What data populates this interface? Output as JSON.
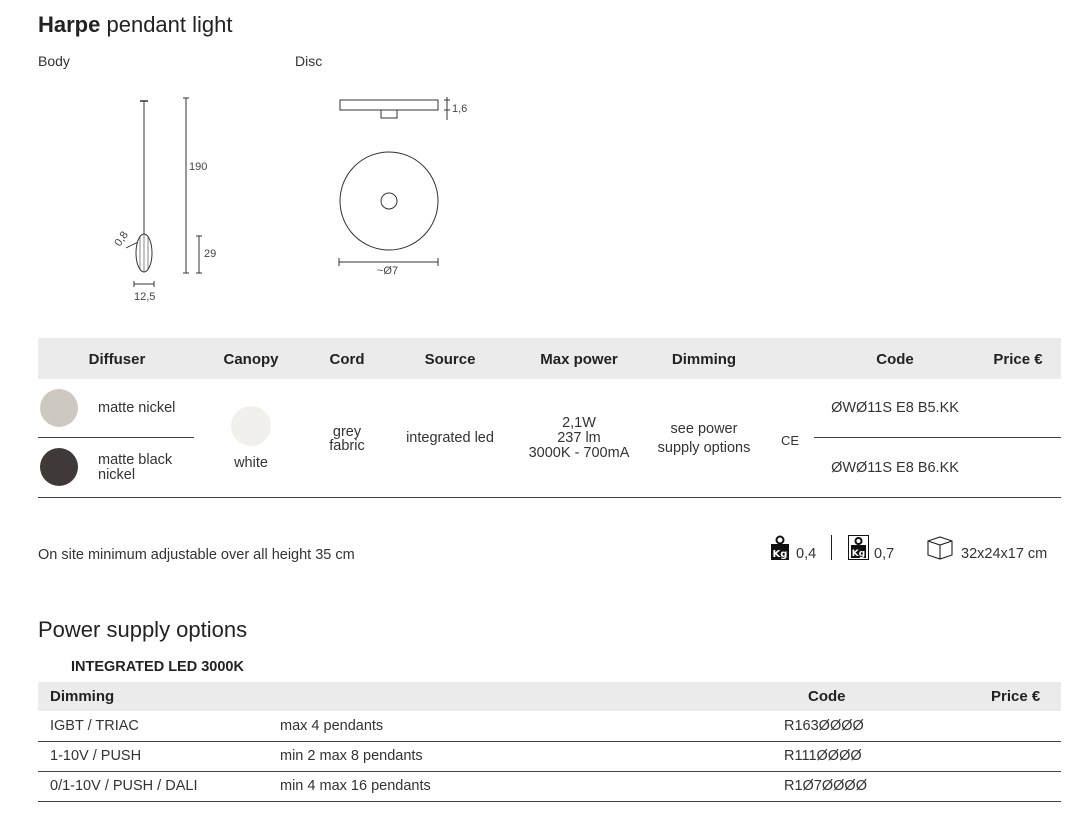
{
  "product": {
    "name": "Harpe",
    "type": "pendant light"
  },
  "drawings": {
    "body_label": "Body",
    "disc_label": "Disc",
    "body_dims": {
      "height": "190",
      "body_height": "29",
      "cord": "0,8",
      "width": "12,5"
    },
    "disc_dims": {
      "thickness": "1,6",
      "diameter": "~Ø7"
    }
  },
  "spec_table": {
    "headers": {
      "diffuser": "Diffuser",
      "canopy": "Canopy",
      "cord": "Cord",
      "source": "Source",
      "max_power": "Max power",
      "dimming": "Dimming",
      "code": "Code",
      "price": "Price €"
    },
    "rows": [
      {
        "diffuser": "matte nickel",
        "swatch_color": "#cdc9c2",
        "code": "ØWØ11S E8 B5.KK"
      },
      {
        "diffuser": "matte black nickel",
        "swatch_color": "#3f3a38",
        "code": "ØWØ11S E8 B6.KK"
      }
    ],
    "canopy": {
      "label": "white",
      "swatch_color": "#f2f0ec"
    },
    "cord": {
      "line1": "grey",
      "line2": "fabric"
    },
    "source": "integrated led",
    "max_power": {
      "line1": "2,1W",
      "line2": "237 lm",
      "line3": "3000K - 700mA"
    },
    "dimming": {
      "line1": "see power",
      "line2": "supply options"
    },
    "ce_mark": "CE"
  },
  "info": {
    "note": "On site minimum adjustable over all height 35 cm",
    "net_weight": "0,4",
    "gross_weight": "0,7",
    "package_size": "32x24x17 cm",
    "kg_icon_text": "Kg"
  },
  "power_supply": {
    "title": "Power supply options",
    "subtitle": "INTEGRATED LED 3000K",
    "headers": {
      "dimming": "Dimming",
      "code": "Code",
      "price": "Price €"
    },
    "rows": [
      {
        "dimming": "IGBT / TRIAC",
        "desc": "max 4 pendants",
        "code": "R163ØØØØ"
      },
      {
        "dimming": "1-10V / PUSH",
        "desc": "min 2 max 8 pendants",
        "code": "R111ØØØØ"
      },
      {
        "dimming": "0/1-10V / PUSH / DALI",
        "desc": "min 4 max 16 pendants",
        "code": "R1Ø7ØØØØ"
      }
    ]
  }
}
